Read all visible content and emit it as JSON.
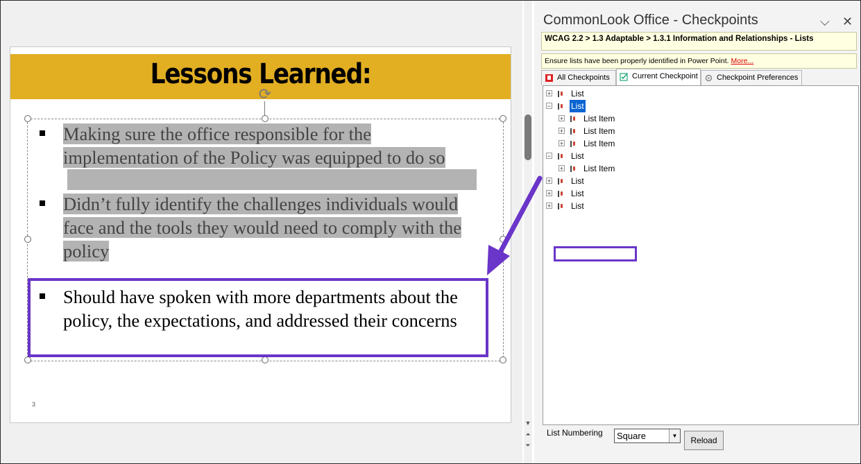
{
  "slide": {
    "title": "Lessons Learned:",
    "bullets": [
      {
        "lines": [
          "Making sure the office responsible for the",
          "implementation of the Policy was equipped to do so"
        ]
      },
      {
        "lines": [
          "Didn’t fully identify the challenges individuals would",
          "face and the tools they would need to comply with the",
          "policy"
        ]
      },
      {
        "lines": [
          "Should have spoken with more departments about the",
          "policy, the expectations, and addressed their concerns"
        ]
      }
    ],
    "slide_number": "3"
  },
  "panel": {
    "title": "CommonLook Office - Checkpoints",
    "breadcrumb": "WCAG 2.2 > 1.3 Adaptable > 1.3.1 Information and Relationships - Lists",
    "description": "Ensure lists have been properly identified in Power Point.",
    "more_link": "More...",
    "tabs": [
      "All Checkpoints",
      "Current Checkpoint",
      "Checkpoint Preferences"
    ],
    "active_tab": "Current Checkpoint",
    "tree": [
      {
        "label": "List",
        "level": 0,
        "expander": "+"
      },
      {
        "label": "List",
        "level": 0,
        "expander": "−",
        "selected": true
      },
      {
        "label": "List Item",
        "level": 1,
        "expander": "+"
      },
      {
        "label": "List Item",
        "level": 1,
        "expander": "+"
      },
      {
        "label": "List Item",
        "level": 1,
        "expander": "+"
      },
      {
        "label": "List",
        "level": 0,
        "expander": "−"
      },
      {
        "label": "List Item",
        "level": 1,
        "expander": "+"
      },
      {
        "label": "List",
        "level": 0,
        "expander": "+"
      },
      {
        "label": "List",
        "level": 0,
        "expander": "+"
      },
      {
        "label": "List",
        "level": 0,
        "expander": "+"
      }
    ],
    "list_numbering_label": "List Numbering",
    "list_numbering_value": "Square",
    "reload_label": "Reload"
  },
  "colors": {
    "title_bar": "#e2ae22",
    "highlight": "#b3b3b3",
    "annotation": "#6a35c9",
    "tree_selection": "#0a64d2",
    "breadcrumb_bg": "#ffffe1"
  }
}
